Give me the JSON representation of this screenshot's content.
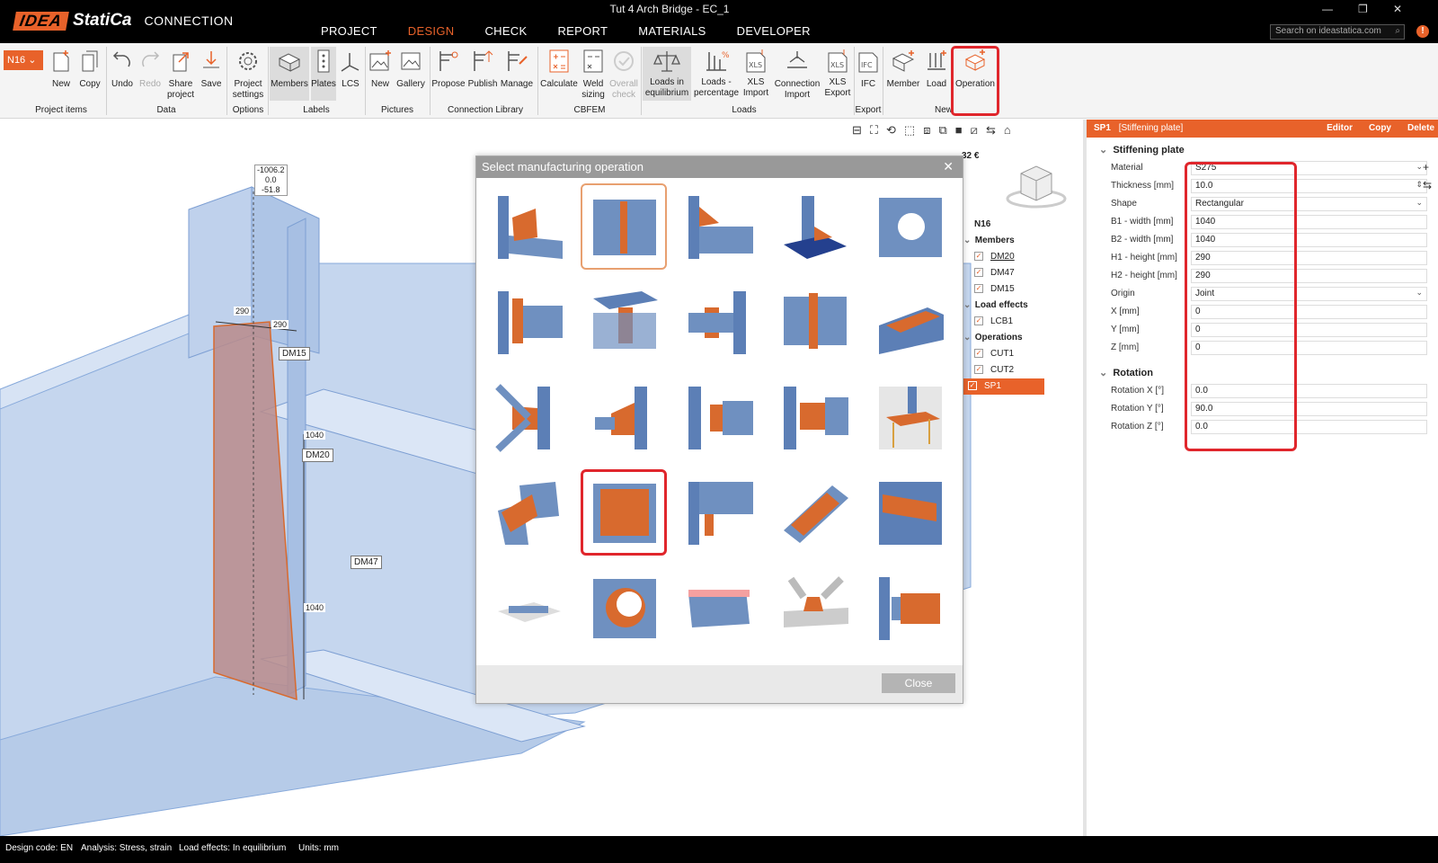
{
  "app": {
    "logo_idea": "IDEA",
    "logo_statica": "StatiCa",
    "product": "CONNECTION",
    "window_title": "Tut 4 Arch Bridge - EC_1"
  },
  "menu": [
    {
      "label": "PROJECT"
    },
    {
      "label": "DESIGN",
      "active": true
    },
    {
      "label": "CHECK"
    },
    {
      "label": "REPORT"
    },
    {
      "label": "MATERIALS"
    },
    {
      "label": "DEVELOPER"
    }
  ],
  "search": {
    "placeholder": "Search on ideastatica.com"
  },
  "ribbon": {
    "node_selector": "N16",
    "buttons": {
      "new": "New",
      "copy": "Copy",
      "undo": "Undo",
      "redo": "Redo",
      "share_1": "Share",
      "share_2": "project",
      "save": "Save",
      "settings_1": "Project",
      "settings_2": "settings",
      "members": "Members",
      "plates": "Plates",
      "lcs": "LCS",
      "pic_new": "New",
      "gallery": "Gallery",
      "propose": "Propose",
      "publish": "Publish",
      "manage": "Manage",
      "calculate": "Calculate",
      "weld_1": "Weld",
      "weld_2": "sizing",
      "overall_1": "Overall",
      "overall_2": "check",
      "loads_eq_1": "Loads in",
      "loads_eq_2": "equilibrium",
      "loads_pct_1": "Loads -",
      "loads_pct_2": "percentage",
      "xls_imp_1": "XLS",
      "xls_imp_2": "Import",
      "conn_imp_1": "Connection",
      "conn_imp_2": "Import",
      "xls_exp_1": "XLS",
      "xls_exp_2": "Export",
      "ifc": "IFC",
      "member": "Member",
      "load": "Load",
      "operation": "Operation"
    },
    "groups": {
      "project_items": "Project items",
      "data": "Data",
      "options": "Options",
      "labels": "Labels",
      "pictures": "Pictures",
      "conn_library": "Connection Library",
      "cbfem": "CBFEM",
      "loads": "Loads",
      "export": "Export",
      "new": "New"
    }
  },
  "viewport": {
    "tags": {
      "dm15": "DM15",
      "dm20": "DM20",
      "dm47": "DM47"
    },
    "dims": {
      "a": "290",
      "b": "290",
      "c": "1040",
      "d": "1040"
    },
    "coord": {
      "x": "-1006.2",
      "y": "0.0",
      "z": "-51.8"
    },
    "cost_fragment": "32 €"
  },
  "tree": {
    "node": "N16",
    "members_header": "Members",
    "members": [
      "DM20",
      "DM47",
      "DM15"
    ],
    "load_header": "Load effects",
    "loads": [
      "LCB1"
    ],
    "ops_header": "Operations",
    "ops": [
      "CUT1",
      "CUT2"
    ],
    "selected_op": "SP1"
  },
  "dialog": {
    "title": "Select manufacturing operation",
    "close_label": "Close"
  },
  "props": {
    "header_id": "SP1",
    "header_type": "[Stiffening plate]",
    "actions": {
      "editor": "Editor",
      "copy": "Copy",
      "delete": "Delete"
    },
    "section1": "Stiffening plate",
    "rows": {
      "material": {
        "label": "Material",
        "value": "S275"
      },
      "thickness": {
        "label": "Thickness [mm]",
        "value": "10.0"
      },
      "shape": {
        "label": "Shape",
        "value": "Rectangular"
      },
      "b1": {
        "label": "B1 - width [mm]",
        "value": "1040"
      },
      "b2": {
        "label": "B2 - width [mm]",
        "value": "1040"
      },
      "h1": {
        "label": "H1 - height [mm]",
        "value": "290"
      },
      "h2": {
        "label": "H2 - height [mm]",
        "value": "290"
      },
      "origin": {
        "label": "Origin",
        "value": "Joint"
      },
      "x": {
        "label": "X [mm]",
        "value": "0"
      },
      "y": {
        "label": "Y [mm]",
        "value": "0"
      },
      "z": {
        "label": "Z [mm]",
        "value": "0"
      }
    },
    "section2": "Rotation",
    "rot": {
      "rx": {
        "label": "Rotation X [°]",
        "value": "0.0"
      },
      "ry": {
        "label": "Rotation Y [°]",
        "value": "90.0"
      },
      "rz": {
        "label": "Rotation Z [°]",
        "value": "0.0"
      }
    }
  },
  "status": {
    "design_code": "Design code: EN",
    "analysis": "Analysis: Stress, strain",
    "load_effects": "Load effects: In equilibrium",
    "units": "Units: mm"
  },
  "colors": {
    "accent": "#e8622a",
    "highlight": "#e0262c",
    "steel": "#6f90c0",
    "plate": "#d86a2e"
  }
}
